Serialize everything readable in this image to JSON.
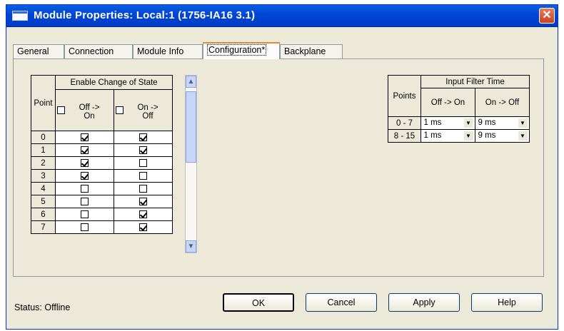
{
  "window": {
    "title": "Module Properties: Local:1 (1756-IA16 3.1)"
  },
  "tabs": [
    {
      "label": "General"
    },
    {
      "label": "Connection"
    },
    {
      "label": "Module Info"
    },
    {
      "label": "Configuration*"
    },
    {
      "label": "Backplane"
    }
  ],
  "active_tab": "Configuration*",
  "cos_table": {
    "header_point": "Point",
    "header_group": "Enable Change of State",
    "header_off_on": "Off ->\nOn",
    "header_on_off": "On ->\nOff",
    "rows": [
      {
        "point": "0",
        "off_on": true,
        "on_off": true
      },
      {
        "point": "1",
        "off_on": true,
        "on_off": true
      },
      {
        "point": "2",
        "off_on": true,
        "on_off": false
      },
      {
        "point": "3",
        "off_on": true,
        "on_off": false
      },
      {
        "point": "4",
        "off_on": false,
        "on_off": false
      },
      {
        "point": "5",
        "off_on": false,
        "on_off": true
      },
      {
        "point": "6",
        "off_on": false,
        "on_off": true
      },
      {
        "point": "7",
        "off_on": false,
        "on_off": true
      }
    ]
  },
  "filter_table": {
    "header_points": "Points",
    "header_group": "Input Filter Time",
    "header_off_on": "Off -> On",
    "header_on_off": "On -> Off",
    "rows": [
      {
        "points": "0 - 7",
        "off_on": "1 ms",
        "on_off": "9 ms"
      },
      {
        "points": "8 - 15",
        "off_on": "1 ms",
        "on_off": "9 ms"
      }
    ]
  },
  "status": {
    "label": "Status:",
    "value": "Offline"
  },
  "buttons": {
    "ok": "OK",
    "cancel": "Cancel",
    "apply": "Apply",
    "help": "Help"
  },
  "icons": [
    "window-icon",
    "close-icon",
    "scroll-up-arrow-icon",
    "scroll-down-arrow-icon",
    "dropdown-arrow-icon"
  ],
  "colors": {
    "titlebar": "#0046d5",
    "dialog_bg": "#ece9d8",
    "close": "#c94320"
  }
}
